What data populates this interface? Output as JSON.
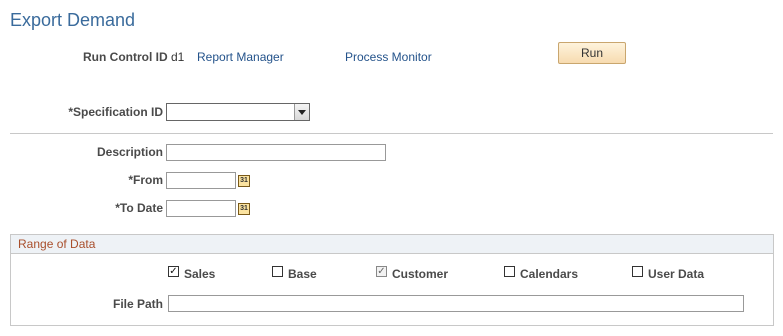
{
  "page": {
    "title": "Export Demand"
  },
  "run_bar": {
    "run_control_label": "Run Control ID",
    "run_control_value": "d1",
    "report_manager_link": "Report Manager",
    "process_monitor_link": "Process Monitor",
    "run_button": "Run"
  },
  "spec": {
    "label": "*Specification ID",
    "value": ""
  },
  "form": {
    "description_label": "Description",
    "description_value": "",
    "from_label": "*From",
    "from_value": "",
    "to_label": "*To Date",
    "to_value": "",
    "calendar_glyph": "31"
  },
  "range": {
    "title": "Range of Data",
    "checkboxes": [
      {
        "label": "Sales",
        "checked": true,
        "enabled": true
      },
      {
        "label": "Base",
        "checked": false,
        "enabled": true
      },
      {
        "label": "Customer",
        "checked": true,
        "enabled": false
      },
      {
        "label": "Calendars",
        "checked": false,
        "enabled": true
      },
      {
        "label": "User Data",
        "checked": false,
        "enabled": true
      }
    ],
    "file_path_label": "File Path",
    "file_path_value": ""
  },
  "colors": {
    "title": "#3a6b9c",
    "link": "#24538b",
    "group_title": "#a94f2c"
  }
}
